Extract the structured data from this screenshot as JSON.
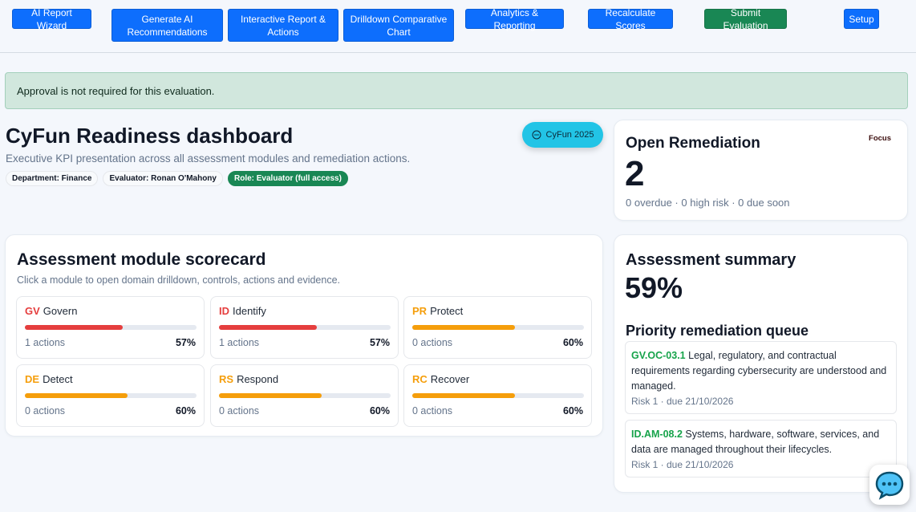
{
  "toolbar": {
    "ai_wizard": "AI Report Wizard",
    "gen_ai": "Generate AI Recommendations",
    "interactive": "Interactive Report & Actions",
    "drilldown": "Drilldown Comparative Chart",
    "analytics": "Analytics & Reporting",
    "recalc": "Recalculate Scores",
    "submit": "Submit Evaluation",
    "setup": "Setup"
  },
  "alert": {
    "text": "Approval is not required for this evaluation."
  },
  "hero": {
    "title": "CyFun Readiness dashboard",
    "subtitle": "Executive KPI presentation across all assessment modules and remediation actions.",
    "chips": {
      "department": "Department: Finance",
      "evaluator": "Evaluator: Ronan O'Mahony",
      "role": "Role: Evaluator (full access)"
    },
    "pill": "CyFun 2025"
  },
  "open_remediation": {
    "title": "Open Remediation",
    "focus": "Focus",
    "count": "2",
    "meta": "0 overdue · 0 high risk · 0 due soon"
  },
  "scorecard": {
    "title": "Assessment module scorecard",
    "subtitle": "Click a module to open domain drilldown, controls, actions and evidence.",
    "modules": [
      {
        "code": "GV",
        "name": "Govern",
        "actions": "1 actions",
        "pct_label": "57%",
        "pct": 57,
        "color": "#e53e3e"
      },
      {
        "code": "ID",
        "name": "Identify",
        "actions": "1 actions",
        "pct_label": "57%",
        "pct": 57,
        "color": "#e53e3e"
      },
      {
        "code": "PR",
        "name": "Protect",
        "actions": "0 actions",
        "pct_label": "60%",
        "pct": 60,
        "color": "#f59e0b"
      },
      {
        "code": "DE",
        "name": "Detect",
        "actions": "0 actions",
        "pct_label": "60%",
        "pct": 60,
        "color": "#f59e0b"
      },
      {
        "code": "RS",
        "name": "Respond",
        "actions": "0 actions",
        "pct_label": "60%",
        "pct": 60,
        "color": "#f59e0b"
      },
      {
        "code": "RC",
        "name": "Recover",
        "actions": "0 actions",
        "pct_label": "60%",
        "pct": 60,
        "color": "#f59e0b"
      }
    ]
  },
  "summary": {
    "title": "Assessment summary",
    "pct": "59%",
    "queue_title": "Priority remediation queue",
    "queue": [
      {
        "code": "GV.OC-03.1",
        "text": "Legal, regulatory, and contractual requirements regarding cybersecurity are understood and managed.",
        "meta": "Risk 1 · due 21/10/2026"
      },
      {
        "code": "ID.AM-08.2",
        "text": "Systems, hardware, software, services, and data are managed throughout their lifecycles.",
        "meta": "Risk 1 · due 21/10/2026"
      }
    ]
  },
  "colors": {
    "primary": "#0d6efd",
    "success": "#198754",
    "pill": "#22c4e6",
    "low": "#e53e3e",
    "mid": "#f59e0b"
  }
}
